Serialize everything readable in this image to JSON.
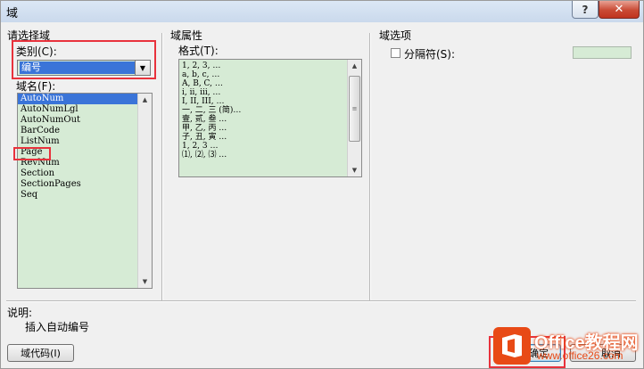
{
  "window": {
    "title": "域",
    "help_label": "?",
    "close_label": "✕"
  },
  "left_panel": {
    "section_title": "请选择域",
    "category_label": "类别(C):",
    "category_value": "编号",
    "field_names_label": "域名(F):",
    "field_names": [
      "AutoNum",
      "AutoNumLgl",
      "AutoNumOut",
      "BarCode",
      "ListNum",
      "Page",
      "RevNum",
      "Section",
      "SectionPages",
      "Seq"
    ],
    "selected_field_name": "AutoNum"
  },
  "middle_panel": {
    "section_title": "域属性",
    "format_label": "格式(T):",
    "formats": [
      "1, 2, 3, …",
      "a, b, c, …",
      "A, B, C, …",
      "i, ii, iii, …",
      "I, II, III, …",
      "一, 二, 三 (简)…",
      "壹, 贰, 叁 …",
      "甲, 乙, 丙 …",
      "子, 丑, 寅 …",
      "1, 2, 3 …",
      "⑴, ⑵, ⑶ …"
    ]
  },
  "right_panel": {
    "section_title": "域选项",
    "separator_label": "分隔符(S):"
  },
  "description": {
    "label": "说明:",
    "text": "插入自动编号"
  },
  "buttons": {
    "field_codes": "域代码(I)",
    "ok": "确定",
    "cancel": "取消"
  },
  "watermark": {
    "title": "Office教程网",
    "url": "www.office26.com"
  },
  "colors": {
    "field_background": "#d6ebd5",
    "selection": "#3a74d8",
    "highlight_box": "#e8323c",
    "watermark": "#e84a16"
  }
}
